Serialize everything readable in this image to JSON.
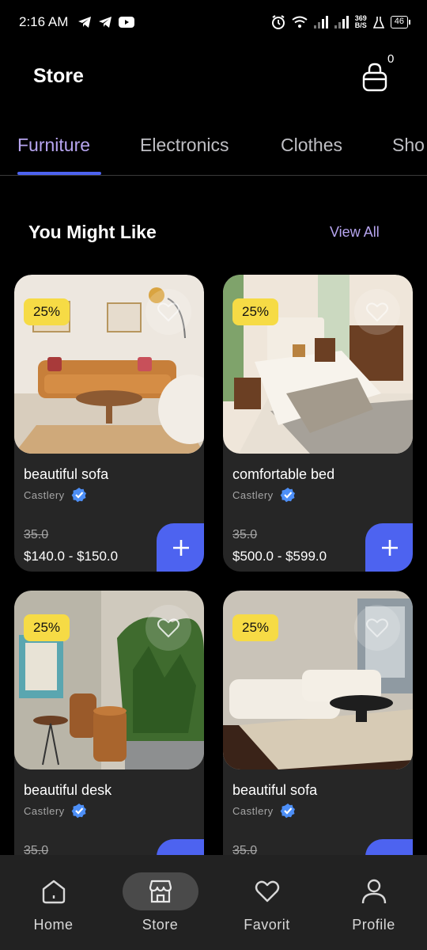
{
  "status_bar": {
    "time": "2:16 AM",
    "net_speed_value": "369",
    "net_speed_unit": "B/S",
    "battery": "46"
  },
  "header": {
    "title": "Store",
    "cart_count": "0"
  },
  "tabs": [
    {
      "label": "Furniture",
      "active": true
    },
    {
      "label": "Electronics",
      "active": false
    },
    {
      "label": "Clothes",
      "active": false
    },
    {
      "label": "Sho",
      "active": false
    }
  ],
  "section": {
    "title": "You Might Like",
    "view_all": "View All"
  },
  "products": [
    {
      "name": "beautiful sofa",
      "brand": "Castlery",
      "discount": "25%",
      "old_price": "35.0",
      "price": "$140.0 - $150.0"
    },
    {
      "name": "comfortable bed",
      "brand": "Castlery",
      "discount": "25%",
      "old_price": "35.0",
      "price": "$500.0 - $599.0"
    },
    {
      "name": "beautiful desk",
      "brand": "Castlery",
      "discount": "25%",
      "old_price": "35.0",
      "price": ""
    },
    {
      "name": "beautiful sofa",
      "brand": "Castlery",
      "discount": "25%",
      "old_price": "35.0",
      "price": ""
    }
  ],
  "bottom_nav": [
    {
      "label": "Home",
      "icon": "home-icon",
      "active": false
    },
    {
      "label": "Store",
      "icon": "store-icon",
      "active": true
    },
    {
      "label": "Favorit",
      "icon": "heart-icon",
      "active": false
    },
    {
      "label": "Profile",
      "icon": "profile-icon",
      "active": false
    }
  ],
  "colors": {
    "background": "#000000",
    "accent": "#4d63f0",
    "accent_text": "#b7a5f0",
    "card": "#262626",
    "badge": "#f6db45",
    "nav": "#222222"
  }
}
